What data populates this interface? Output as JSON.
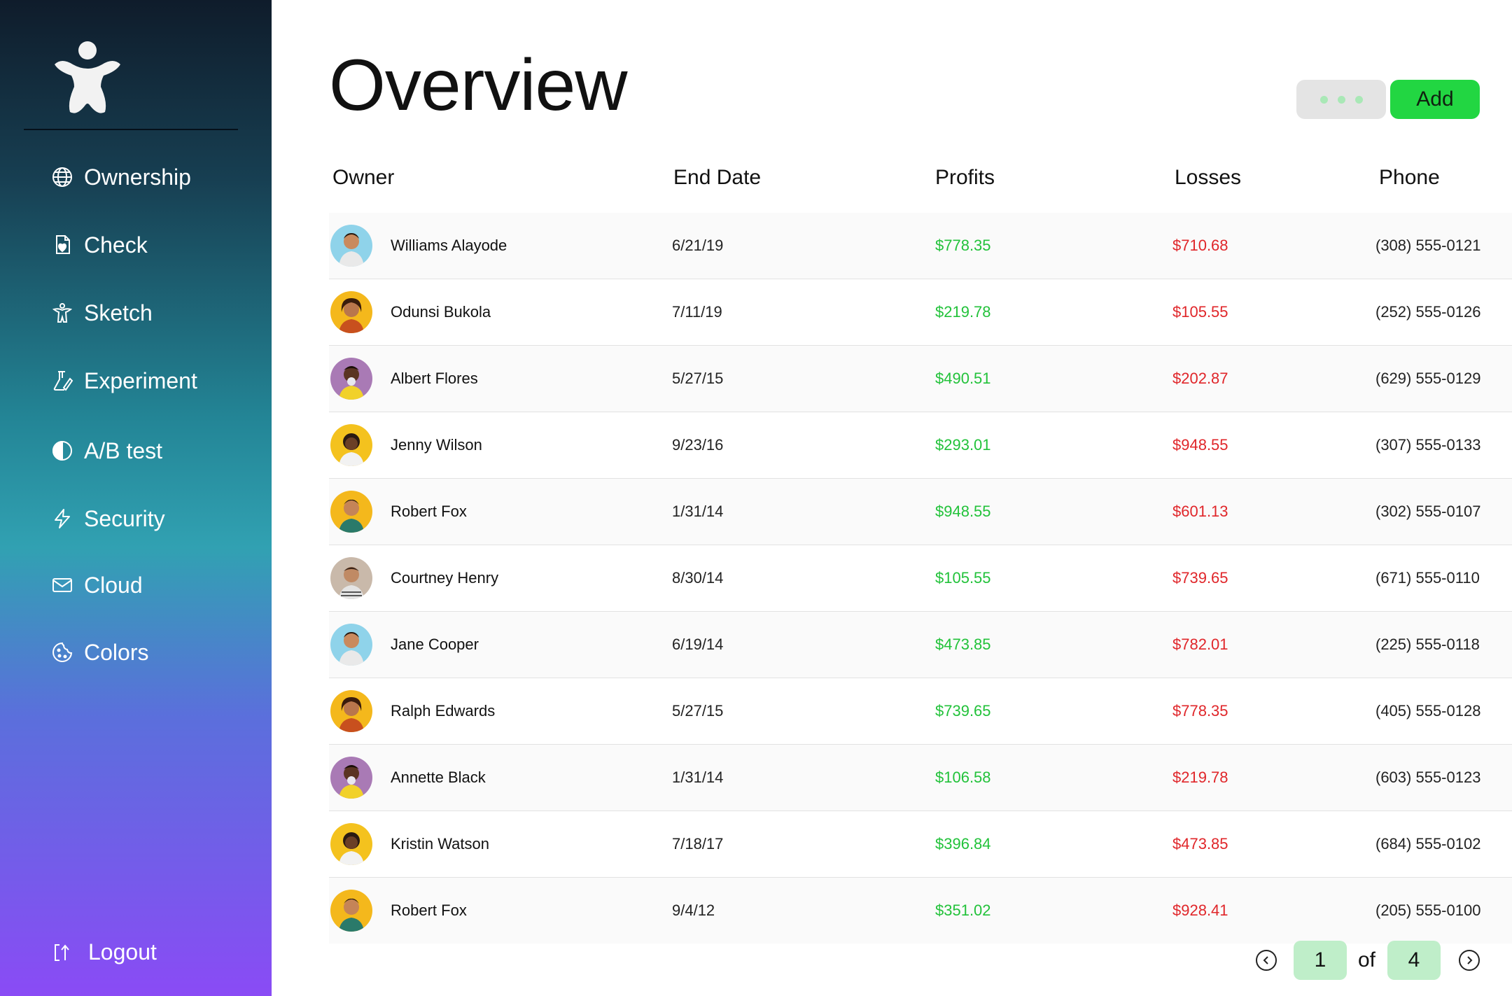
{
  "sidebar": {
    "logo_icon": "figure-logo-icon",
    "items": [
      {
        "label": "Ownership",
        "icon": "globe-icon"
      },
      {
        "label": "Check",
        "icon": "document-heart-icon"
      },
      {
        "label": "Sketch",
        "icon": "figure-icon"
      },
      {
        "label": "Experiment",
        "icon": "flask-icon"
      },
      {
        "label": "A/B test",
        "icon": "half-circle-icon"
      },
      {
        "label": "Security",
        "icon": "lightning-icon"
      },
      {
        "label": "Cloud",
        "icon": "mail-icon"
      },
      {
        "label": "Colors",
        "icon": "cookie-icon"
      }
    ],
    "logout_label": "Logout",
    "logout_icon": "logout-icon"
  },
  "header": {
    "title": "Overview",
    "more_icon": "more-dots-icon",
    "add_label": "Add"
  },
  "table": {
    "columns": [
      "Owner",
      "End Date",
      "Profits",
      "Losses",
      "Phone"
    ],
    "rows": [
      {
        "owner": "Williams Alayode",
        "end_date": "6/21/19",
        "profits": "$778.35",
        "losses": "$710.68",
        "phone": "(308) 555-0121"
      },
      {
        "owner": "Odunsi Bukola",
        "end_date": "7/11/19",
        "profits": "$219.78",
        "losses": "$105.55",
        "phone": "(252) 555-0126"
      },
      {
        "owner": "Albert Flores",
        "end_date": "5/27/15",
        "profits": "$490.51",
        "losses": "$202.87",
        "phone": "(629) 555-0129"
      },
      {
        "owner": "Jenny Wilson",
        "end_date": "9/23/16",
        "profits": "$293.01",
        "losses": "$948.55",
        "phone": "(307) 555-0133"
      },
      {
        "owner": "Robert Fox",
        "end_date": "1/31/14",
        "profits": "$948.55",
        "losses": "$601.13",
        "phone": "(302) 555-0107"
      },
      {
        "owner": "Courtney Henry",
        "end_date": "8/30/14",
        "profits": "$105.55",
        "losses": "$739.65",
        "phone": "(671) 555-0110"
      },
      {
        "owner": "Jane Cooper",
        "end_date": "6/19/14",
        "profits": "$473.85",
        "losses": "$782.01",
        "phone": "(225) 555-0118"
      },
      {
        "owner": "Ralph Edwards",
        "end_date": "5/27/15",
        "profits": "$739.65",
        "losses": "$778.35",
        "phone": "(405) 555-0128"
      },
      {
        "owner": "Annette Black",
        "end_date": "1/31/14",
        "profits": "$106.58",
        "losses": "$219.78",
        "phone": "(603) 555-0123"
      },
      {
        "owner": "Kristin Watson",
        "end_date": "7/18/17",
        "profits": "$396.84",
        "losses": "$473.85",
        "phone": "(684) 555-0102"
      },
      {
        "owner": "Robert Fox",
        "end_date": "9/4/12",
        "profits": "$351.02",
        "losses": "$928.41",
        "phone": "(205) 555-0100"
      }
    ]
  },
  "pagination": {
    "current_page": "1",
    "of_label": "of",
    "total_pages": "4",
    "prev_icon": "chevron-left-circle-icon",
    "next_icon": "chevron-right-circle-icon"
  },
  "colors": {
    "add_button": "#22d642",
    "profit_text": "#22c23a",
    "loss_text": "#e0262a",
    "page_box": "#bfeec9",
    "sidebar_top": "#0f1c2b",
    "sidebar_bottom": "#8a4bf5"
  }
}
